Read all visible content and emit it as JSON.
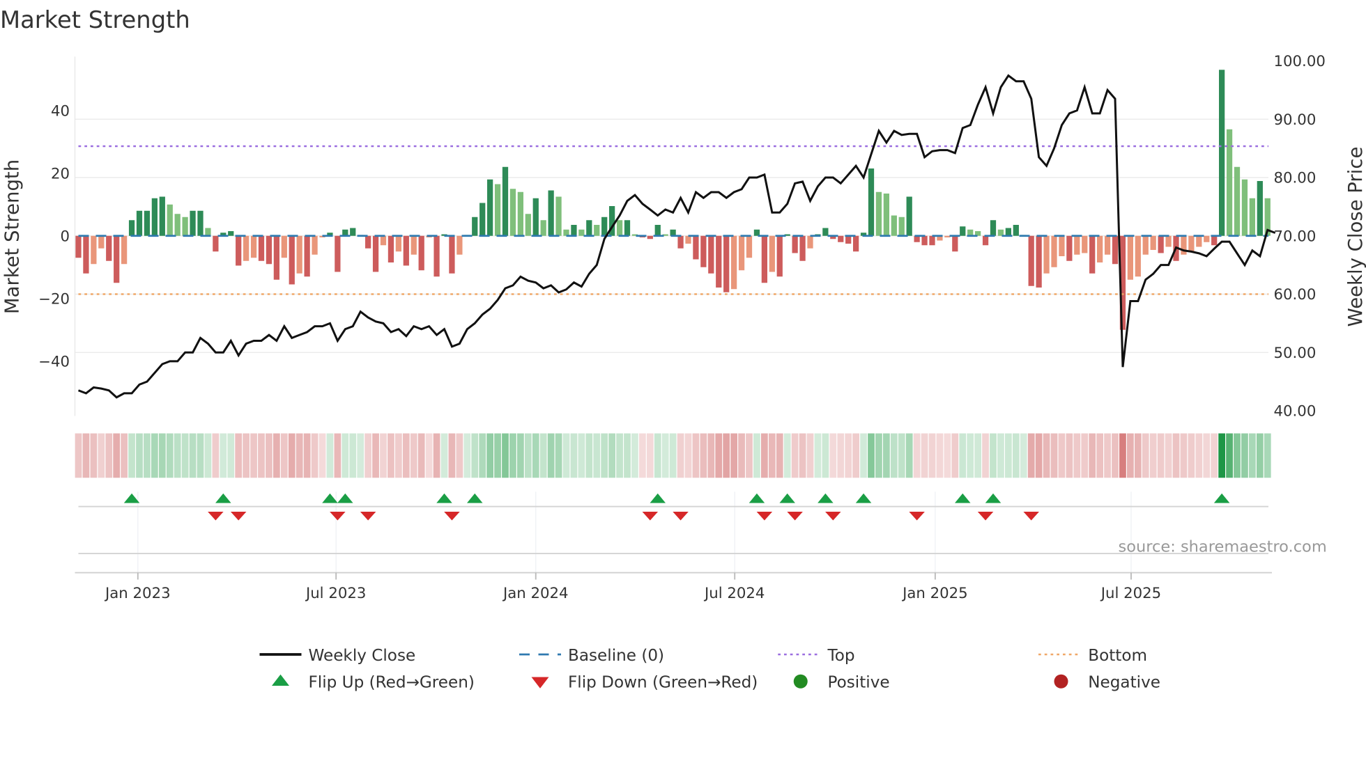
{
  "chart_data": {
    "type": "bar+line",
    "title": "Market Strength",
    "ylabel_left": "Market Strength",
    "ylabel_right": "Weekly Close Price",
    "frequency": "weekly",
    "ylim_left": [
      -57,
      57
    ],
    "ylim_right": [
      40,
      100
    ],
    "yticks_left": [
      "40",
      "20",
      "0",
      "−20",
      "−40"
    ],
    "yticks_left_values": [
      40,
      20,
      0,
      -20,
      -40
    ],
    "yticks_right": [
      "100.00",
      "90.00",
      "80.00",
      "70.00",
      "60.00",
      "50.00",
      "40.00"
    ],
    "yticks_right_values": [
      100,
      90,
      80,
      70,
      60,
      50,
      40
    ],
    "xticks": [
      "Jan 2023",
      "Jul 2023",
      "Jan 2024",
      "Jul 2024",
      "Jan 2025",
      "Jul 2025"
    ],
    "xtick_week_index": [
      7.8,
      33.8,
      60,
      86.1,
      112.4,
      138.1
    ],
    "top_level": 28.6,
    "bottom_level": -18.6,
    "baseline": 0,
    "strength": [
      -7,
      -12,
      -9,
      -4,
      -8,
      -15,
      -9,
      5,
      8,
      8,
      12,
      12.5,
      10,
      7,
      6,
      8,
      8,
      2.5,
      -5,
      1,
      1.5,
      -9.5,
      -8,
      -7,
      -8,
      -9,
      -14,
      -7,
      -15.5,
      -12,
      -13,
      -6,
      -0.5,
      1,
      -11.5,
      2,
      2.5,
      0.3,
      -4,
      -11.5,
      -3,
      -8.5,
      -5,
      -9.5,
      -6,
      -11,
      -0.5,
      -13,
      0.5,
      -12,
      -6,
      0.3,
      6,
      10.5,
      18,
      16.5,
      22,
      15,
      14,
      7,
      12,
      5,
      14.5,
      12.5,
      2,
      3.5,
      2,
      5,
      3.5,
      6,
      9.5,
      5,
      5,
      0.5,
      -0.5,
      -1,
      3.5,
      0.5,
      2,
      -4,
      -2.5,
      -7.5,
      -10,
      -12,
      -16.5,
      -18,
      -17,
      -11,
      -7,
      2,
      -15,
      -11.5,
      -13,
      0.5,
      -5.5,
      -8,
      -4,
      0.5,
      2.5,
      -1,
      -2,
      -2.5,
      -5,
      1,
      21.5,
      14,
      13.5,
      6.5,
      6,
      12.5,
      -2,
      -3,
      -3,
      -1.5,
      -0.5,
      -5,
      3,
      2,
      1.5,
      -3,
      5,
      2,
      2.5,
      3.5,
      0.3,
      -16,
      -16.5,
      -12,
      -10,
      -6.5,
      -8,
      -6,
      -5.5,
      -12,
      -8.5,
      -6,
      -9,
      -30,
      -14,
      -13,
      -6,
      -4.5,
      -5.5,
      -3.5,
      -8,
      -6,
      -5,
      -3.5,
      -2,
      -3,
      53,
      34,
      22,
      18,
      12,
      17.5,
      12
    ],
    "weekly_close": [
      43.5,
      43,
      44,
      43.8,
      43.5,
      42.3,
      43,
      43,
      44.5,
      45,
      46.5,
      48,
      48.5,
      48.5,
      50,
      50,
      52.5,
      51.5,
      50,
      50,
      52,
      49.5,
      51.5,
      52,
      52,
      53,
      52,
      54.5,
      52.5,
      53,
      53.5,
      54.5,
      54.5,
      55,
      52,
      54,
      54.5,
      57,
      56,
      55.3,
      55,
      53.5,
      54,
      52.8,
      54.5,
      54,
      54.5,
      53,
      54,
      51,
      51.5,
      54,
      55,
      56.5,
      57.5,
      59,
      61,
      61.5,
      63,
      62.3,
      62,
      61,
      61.5,
      60.3,
      60.8,
      62,
      61.3,
      63.5,
      65,
      69.5,
      71.5,
      73.5,
      76,
      77,
      75.5,
      74.5,
      73.5,
      74.5,
      74,
      76.5,
      74,
      77.5,
      76.5,
      77.5,
      77.5,
      76.5,
      77.5,
      78,
      80,
      80,
      80.5,
      74,
      74,
      75.5,
      79,
      79.3,
      76,
      78.5,
      80,
      80,
      79,
      80.5,
      82,
      80,
      84,
      88,
      86,
      88,
      87.3,
      87.5,
      87.5,
      83.5,
      84.5,
      84.7,
      84.7,
      84.2,
      88.5,
      89,
      92.5,
      95.5,
      91,
      95.5,
      97.5,
      96.5,
      96.5,
      93.5,
      83.5,
      82,
      85,
      89,
      91,
      91.5,
      95.5,
      91,
      91,
      95,
      93.5,
      47.5,
      58.8,
      58.8,
      62.5,
      63.5,
      65,
      65,
      68,
      67.5,
      67.3,
      67,
      66.5,
      67.8,
      69,
      69,
      67,
      65,
      67.5,
      66.5,
      71,
      70.5
    ],
    "flip_up_week_index": [
      7,
      19,
      33,
      35,
      48,
      52,
      76,
      89,
      93,
      98,
      103,
      116,
      120,
      150
    ],
    "flip_down_week_index": [
      18,
      21,
      34,
      38,
      49,
      75,
      79,
      90,
      94,
      99,
      110,
      119,
      125
    ],
    "legend": [
      {
        "label": "Weekly Close",
        "kind": "line-solid",
        "color": "#111111"
      },
      {
        "label": "Baseline (0)",
        "kind": "line-dashed",
        "color": "#2f7ab0"
      },
      {
        "label": "Top",
        "kind": "line-dotted",
        "color": "#9b6ee0"
      },
      {
        "label": "Bottom",
        "kind": "line-dotted",
        "color": "#f0a868"
      },
      {
        "label": "Flip Up (Red→Green)",
        "kind": "triangle-up",
        "color": "#1a9e45"
      },
      {
        "label": "Flip Down (Green→Red)",
        "kind": "triangle-down",
        "color": "#d62728"
      },
      {
        "label": "Positive",
        "kind": "circle",
        "color": "#228b22"
      },
      {
        "label": "Negative",
        "kind": "circle",
        "color": "#b22222"
      }
    ],
    "legend_position": "bottom",
    "source": "source: sharemaestro.com",
    "colors": {
      "pos_strong": "#2e8b57",
      "pos_weak": "#7fbf7b",
      "neg_strong": "#cd5c5c",
      "neg_weak": "#e9967a",
      "grid": "#ececec"
    }
  }
}
